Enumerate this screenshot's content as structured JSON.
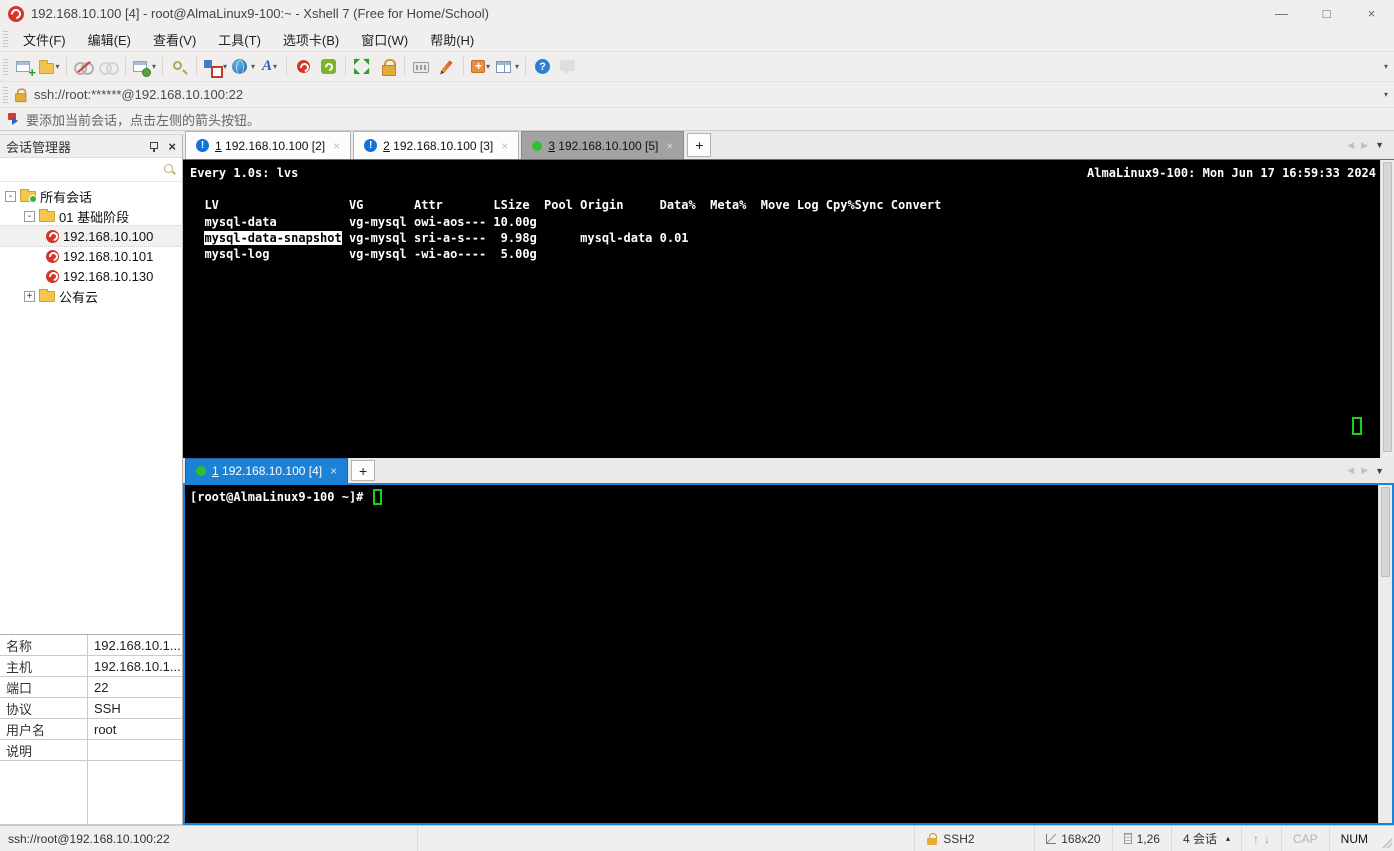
{
  "window": {
    "title": "192.168.10.100 [4] - root@AlmaLinux9-100:~ - Xshell 7 (Free for Home/School)",
    "controls": {
      "minimize": "—",
      "maximize": "□",
      "close": "×"
    }
  },
  "menu": {
    "items": [
      "文件(F)",
      "编辑(E)",
      "查看(V)",
      "工具(T)",
      "选项卡(B)",
      "窗口(W)",
      "帮助(H)"
    ]
  },
  "toolbar": {
    "icons": [
      "new-session",
      "open-session-folder",
      "disconnect",
      "reconnect",
      "session-properties",
      "find",
      "transfer-squares",
      "web-browser",
      "font",
      "xshell",
      "xftp",
      "fullscreen",
      "lock-screen",
      "virtual-keyboard",
      "compose-pen",
      "new-file",
      "tile-windows",
      "help",
      "feedback-bubble"
    ]
  },
  "address_bar": {
    "value": "ssh://root:******@192.168.10.100:22"
  },
  "info_bar": {
    "text": "要添加当前会话，点击左侧的箭头按钮。"
  },
  "glyphs": {
    "close": "×",
    "plus": "+",
    "alert": "!",
    "minus": "-",
    "dropdown_small": "▾",
    "scroll_left": "◀",
    "scroll_right": "▶",
    "dropdown": "▼",
    "arrow_up": "↑",
    "arrow_down": "↓",
    "sessions_caret": "▴",
    "fs_tl": "◤",
    "fs_tr": "◥",
    "fs_bl": "◣",
    "fs_br": "◢",
    "question": "?",
    "font_a": "A"
  },
  "session_manager": {
    "title": "会话管理器",
    "tree": {
      "root": "所有会话",
      "folder1": "01 基础阶段",
      "session1": "192.168.10.100",
      "session2": "192.168.10.101",
      "session3": "192.168.10.130",
      "folder2": "公有云"
    },
    "properties": {
      "rows": [
        {
          "label": "名称",
          "value": "192.168.10.1..."
        },
        {
          "label": "主机",
          "value": "192.168.10.1..."
        },
        {
          "label": "端口",
          "value": "22"
        },
        {
          "label": "协议",
          "value": "SSH"
        },
        {
          "label": "用户名",
          "value": "root"
        },
        {
          "label": "说明",
          "value": ""
        }
      ]
    }
  },
  "top_pane": {
    "tabs": [
      {
        "number": "1",
        "label": " 192.168.10.100 [2]",
        "status": "alert",
        "active": false
      },
      {
        "number": "2",
        "label": " 192.168.10.100 [3]",
        "status": "alert",
        "active": false
      },
      {
        "number": "3",
        "label": " 192.168.10.100 [5]",
        "status": "connected",
        "active": true
      }
    ],
    "terminal": {
      "watch_header_left": "Every 1.0s: lvs",
      "watch_header_right": "AlmaLinux9-100: Mon Jun 17 16:59:33 2024",
      "lvs_header": "  LV                  VG       Attr       LSize  Pool Origin     Data%  Meta%  Move Log Cpy%Sync Convert",
      "row1": "  mysql-data          vg-mysql owi-aos--- 10.00g",
      "row2_prefix": "  ",
      "row2_highlight": "mysql-data-snapshot",
      "row2_rest": " vg-mysql sri-a-s---  9.98g      mysql-data 0.01",
      "row3": "  mysql-log           vg-mysql -wi-ao----  5.00g"
    }
  },
  "bottom_pane": {
    "tabs": [
      {
        "number": "1",
        "label": " 192.168.10.100 [4]",
        "status": "connected",
        "active": true
      }
    ],
    "terminal": {
      "prompt": "[root@AlmaLinux9-100 ~]# "
    }
  },
  "status_bar": {
    "url": "ssh://root@192.168.10.100:22",
    "protocol": "SSH2",
    "terminal_size": "168x20",
    "cursor_position": "1,26",
    "sessions": "4 会话",
    "caps_indicator": "CAP",
    "num_indicator": "NUM"
  }
}
